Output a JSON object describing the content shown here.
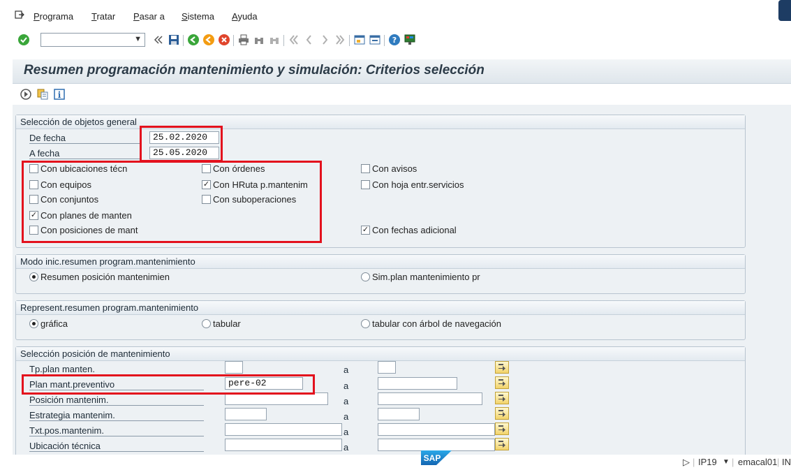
{
  "menu": {
    "items": [
      {
        "prefix": "",
        "u": "P",
        "rest": "rograma"
      },
      {
        "prefix": "",
        "u": "T",
        "rest": "ratar"
      },
      {
        "prefix": "",
        "u": "P",
        "rest": "asar a"
      },
      {
        "prefix": "",
        "u": "S",
        "rest": "istema"
      },
      {
        "prefix": "",
        "u": "A",
        "rest": "yuda"
      }
    ]
  },
  "toolbar": {
    "command_value": "",
    "icons": [
      "enter-icon",
      "back-arrows-icon",
      "save-icon",
      "back-icon",
      "exit-icon",
      "cancel-icon",
      "print-icon",
      "find-icon",
      "find-next-icon",
      "first-page-icon",
      "previous-page-icon",
      "next-page-icon",
      "last-page-icon",
      "new-session-icon",
      "shortcut-icon",
      "help-icon",
      "customize-layout-icon"
    ]
  },
  "title": "Resumen programación mantenimiento y simulación: Criterios selección",
  "app_toolbar": {
    "icons": [
      "execute-icon",
      "get-variant-icon",
      "info-icon"
    ]
  },
  "group1": {
    "title": "Selección de objetos general",
    "from_date_label": "De fecha",
    "from_date": "25.02.2020",
    "to_date_label": "A fecha",
    "to_date": "25.05.2020",
    "checkboxes": [
      {
        "label": "Con ubicaciones técn",
        "checked": false
      },
      {
        "label": "Con equipos",
        "checked": false
      },
      {
        "label": "Con conjuntos",
        "checked": false
      },
      {
        "label": "Con planes de manten",
        "checked": true
      },
      {
        "label": "Con posiciones de mant",
        "checked": false
      },
      {
        "label": "Con órdenes",
        "checked": false
      },
      {
        "label": "Con HRuta p.mantenim",
        "checked": true
      },
      {
        "label": "Con suboperaciones",
        "checked": false
      },
      {
        "label": "Con avisos",
        "checked": false
      },
      {
        "label": "Con hoja entr.servicios",
        "checked": false
      },
      {
        "label": "Con fechas adicional",
        "checked": true
      }
    ]
  },
  "group2": {
    "title": "Modo inic.resumen program.mantenimiento",
    "options": [
      {
        "label": "Resumen posición mantenimien",
        "selected": true
      },
      {
        "label": "Sim.plan mantenimiento pr",
        "selected": false
      }
    ]
  },
  "group3": {
    "title": "Represent.resumen program.mantenimiento",
    "options": [
      {
        "label": "gráfica",
        "selected": true
      },
      {
        "label": "tabular",
        "selected": false
      },
      {
        "label": "tabular con árbol de navegación",
        "selected": false
      }
    ]
  },
  "group4": {
    "title": "Selección posición de mantenimiento",
    "to_label": "a",
    "rows": [
      {
        "label": "Tp.plan manten.",
        "from": "",
        "to": ""
      },
      {
        "label": "Plan mant.preventivo",
        "from": "pere-02",
        "to": ""
      },
      {
        "label": "Posición mantenim.",
        "from": "",
        "to": ""
      },
      {
        "label": "Estrategia mantenim.",
        "from": "",
        "to": ""
      },
      {
        "label": "Txt.pos.mantenim.",
        "from": "",
        "to": ""
      },
      {
        "label": "Ubicación técnica",
        "from": "",
        "to": ""
      }
    ]
  },
  "status": {
    "logo": "SAP",
    "system": "IP19",
    "user": "emacal01",
    "mode": "INS"
  }
}
